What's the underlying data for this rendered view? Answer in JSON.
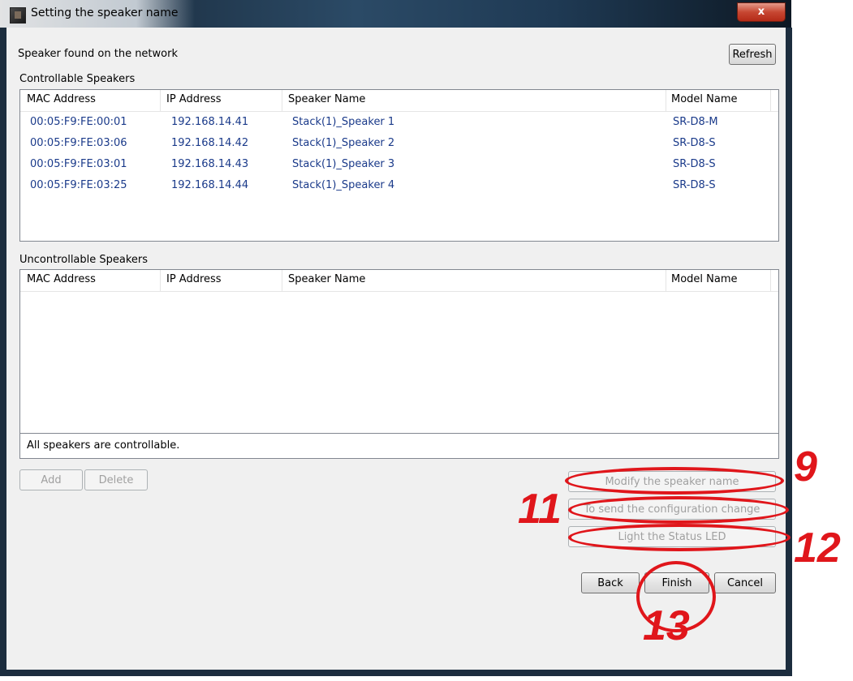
{
  "window": {
    "title": "Setting the speaker name",
    "close_glyph": "x"
  },
  "header": {
    "found_label": "Speaker found on the network",
    "refresh_label": "Refresh"
  },
  "controllable": {
    "label": "Controllable Speakers",
    "columns": [
      "MAC Address",
      "IP Address",
      "Speaker Name",
      "Model Name"
    ],
    "rows": [
      {
        "mac": "00:05:F9:FE:00:01",
        "ip": "192.168.14.41",
        "name": "Stack(1)_Speaker 1",
        "model": "SR-D8-M"
      },
      {
        "mac": "00:05:F9:FE:03:06",
        "ip": "192.168.14.42",
        "name": "Stack(1)_Speaker 2",
        "model": "SR-D8-S"
      },
      {
        "mac": "00:05:F9:FE:03:01",
        "ip": "192.168.14.43",
        "name": "Stack(1)_Speaker 3",
        "model": "SR-D8-S"
      },
      {
        "mac": "00:05:F9:FE:03:25",
        "ip": "192.168.14.44",
        "name": "Stack(1)_Speaker 4",
        "model": "SR-D8-S"
      }
    ]
  },
  "uncontrollable": {
    "label": "Uncontrollable Speakers",
    "columns": [
      "MAC Address",
      "IP Address",
      "Speaker Name",
      "Model Name"
    ]
  },
  "status_text": "All speakers are controllable.",
  "actions": {
    "add_label": "Add",
    "delete_label": "Delete",
    "modify_label": "Modify the speaker name",
    "send_label": "To send the configuration change",
    "light_label": "Light the Status LED"
  },
  "footer": {
    "back_label": "Back",
    "finish_label": "Finish",
    "cancel_label": "Cancel"
  },
  "annotations": {
    "modify": "9",
    "send": "11",
    "light": "12",
    "finish": "13"
  },
  "colors": {
    "annotation": "#e0161b",
    "list_text": "#1a3a8a"
  }
}
